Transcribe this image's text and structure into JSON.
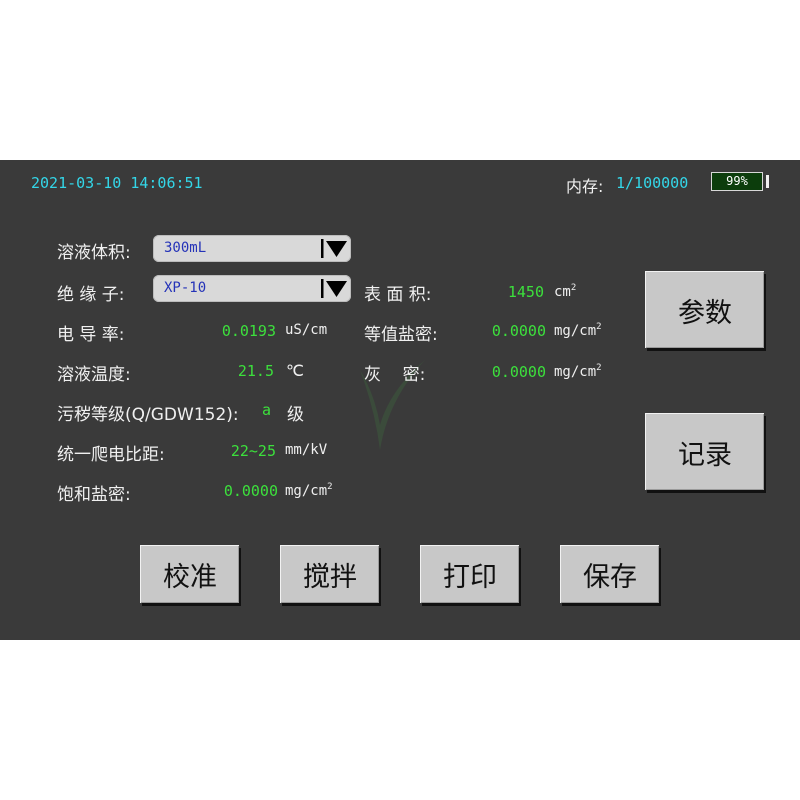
{
  "status_bar": {
    "datetime": "2021-03-10 14:06:51",
    "memory_label": "内存:",
    "memory_value": "1/100000",
    "battery": "99%",
    "battery_level": 0.99
  },
  "form": {
    "volume": {
      "label": "溶液体积:",
      "value": "300mL"
    },
    "insulator": {
      "label": "绝 缘 子:",
      "value": "XP-10"
    },
    "conductivity": {
      "label": "电 导 率:",
      "value": "0.0193",
      "unit": "uS/cm"
    },
    "temperature": {
      "label": "溶液温度:",
      "value": "21.5",
      "unit": "℃"
    },
    "pollution_grade": {
      "label": "污秽等级(Q/GDW152):",
      "value": "a",
      "unit": "级"
    },
    "creepage": {
      "label": "统一爬电比距:",
      "value": "22~25",
      "unit": "mm/kV"
    },
    "saturated_salt": {
      "label": "饱和盐密:",
      "value": "0.0000",
      "unit_base": "mg/cm",
      "unit_sup": "2"
    },
    "surface_area": {
      "label": "表 面 积:",
      "value": "1450",
      "unit_base": "cm",
      "unit_sup": "2"
    },
    "esdd": {
      "label": "等值盐密:",
      "value": "0.0000",
      "unit_base": "mg/cm",
      "unit_sup": "2"
    },
    "nsdd": {
      "label": "灰    密:",
      "value": "0.0000",
      "unit_base": "mg/cm",
      "unit_sup": "2"
    }
  },
  "buttons": {
    "params": "参数",
    "records": "记录",
    "calibrate": "校准",
    "stir": "搅拌",
    "print": "打印",
    "save": "保存"
  },
  "colors": {
    "background": "#3a3a3a",
    "datetime": "#33d6e8",
    "value_green": "#3ce03c",
    "select_text": "#2533b8",
    "button": "#c8c8c8"
  },
  "icons": {
    "dropdown": "triangle-down-icon",
    "battery": "battery-icon"
  }
}
